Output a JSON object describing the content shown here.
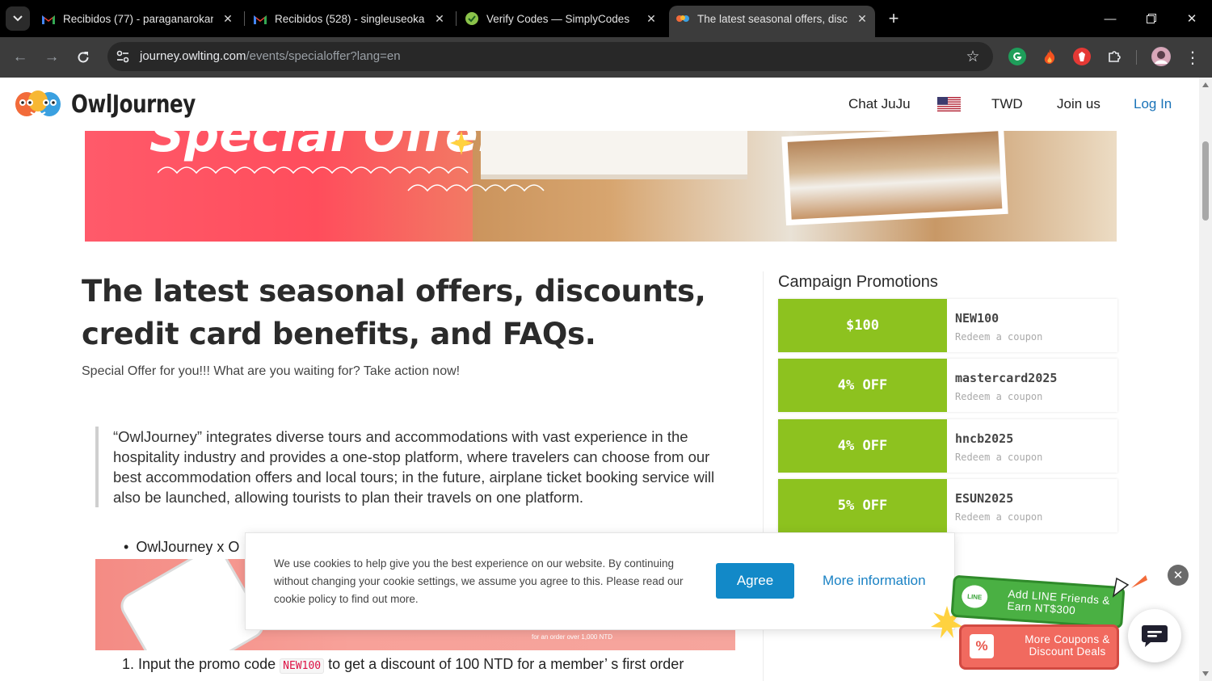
{
  "browser": {
    "tabs": [
      {
        "title": "Recibidos (77) - paraganarokan",
        "favicon": "gmail-icon",
        "active": false
      },
      {
        "title": "Recibidos (528) - singleuseokan",
        "favicon": "gmail-icon",
        "active": false
      },
      {
        "title": "Verify Codes — SimplyCodes",
        "favicon": "simplycodes-icon",
        "active": false
      },
      {
        "title": "The latest seasonal offers, disco",
        "favicon": "owljourney-icon",
        "active": true
      }
    ],
    "url_host": "journey.owlting.com",
    "url_path": "/events/specialoffer?lang=en"
  },
  "header": {
    "logo_text": "OwlJourney",
    "nav": {
      "chat": "Chat JuJu",
      "currency": "TWD",
      "join": "Join us",
      "login": "Log In"
    }
  },
  "hero": {
    "title": "Special Offer"
  },
  "article": {
    "title": "The latest seasonal offers, discounts, credit card benefits, and FAQs.",
    "subtitle": "Special Offer for you!!! What are you waiting for? Take action now!",
    "quote": "“OwlJourney” integrates diverse tours and accommodations with vast experience in the hospitality industry and provides a one-stop platform, where travelers can choose from our best accommodation offers and local tours; in the future, airplane ticket booking service will also be launched, allowing tourists to plan their travels on one platform.",
    "bullet": "OwlJourney x O",
    "banner_small_text": "for an order over 1,000 NTD",
    "step1_prefix": "1. Input the promo code",
    "step1_code": "NEW100",
    "step1_suffix": "to get a discount of 100 NTD for a member’ s first order"
  },
  "sidebar": {
    "title": "Campaign Promotions",
    "coupons": [
      {
        "amount": "$100",
        "code": "NEW100",
        "redeem": "Redeem a coupon"
      },
      {
        "amount": "4% OFF",
        "code": "mastercard2025",
        "redeem": "Redeem a coupon"
      },
      {
        "amount": "4% OFF",
        "code": "hncb2025",
        "redeem": "Redeem a coupon"
      },
      {
        "amount": "5% OFF",
        "code": "ESUN2025",
        "redeem": "Redeem a coupon"
      }
    ]
  },
  "cookie": {
    "text": "We use cookies to help give you the best experience on our website. By continuing without changing your cookie settings, we assume you agree to this. Please read our cookie policy to find out more.",
    "agree": "Agree",
    "more": "More information"
  },
  "floating": {
    "line_badge": "LINE",
    "line_text": "Add LINE Friends & Earn NT$300",
    "coupon_icon": "%",
    "coupon_text": "More Coupons & Discount Deals"
  },
  "colors": {
    "coupon_green": "#8dc21f",
    "link_blue": "#1a73b8",
    "agree_blue": "#1289c8",
    "hero_pink": "#ff4d5c"
  }
}
